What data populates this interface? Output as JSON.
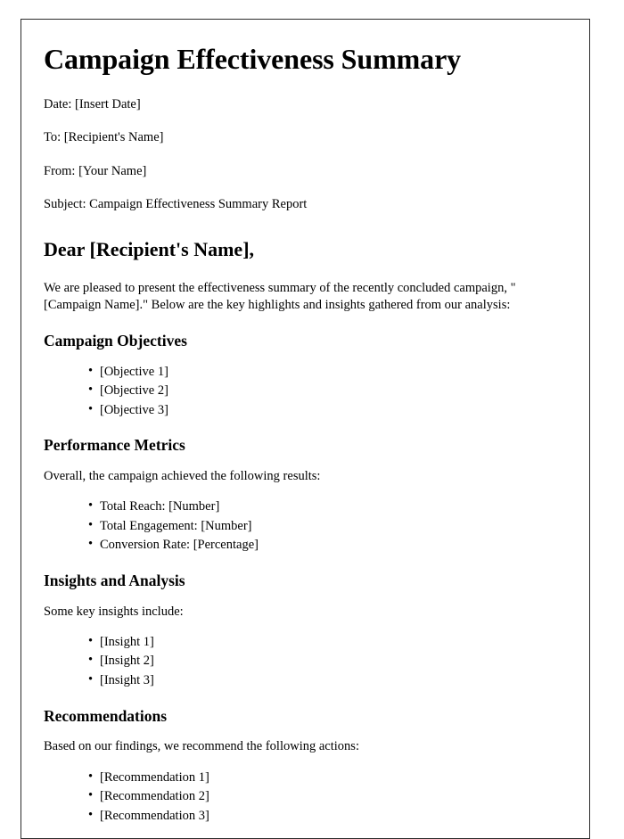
{
  "document": {
    "title": "Campaign Effectiveness Summary",
    "meta": [
      {
        "label": "Date:",
        "value": "[Insert Date]",
        "text": "Date: [Insert Date]"
      },
      {
        "label": "To:",
        "value": "[Recipient's Name]",
        "text": "To: [Recipient's Name]"
      },
      {
        "label": "From:",
        "value": "[Your Name]",
        "text": "From: [Your Name]"
      },
      {
        "label": "Subject:",
        "value": "Campaign Effectiveness Summary Report",
        "text": "Subject: Campaign Effectiveness Summary Report"
      }
    ],
    "salutation": "Dear [Recipient's Name],",
    "intro_paragraph": "We are pleased to present the effectiveness summary of the recently concluded campaign, \"[Campaign Name].\" Below are the key highlights and insights gathered from our analysis:",
    "sections": [
      {
        "heading": "Campaign Objectives",
        "lead_in": "",
        "items": [
          "[Objective 1]",
          "[Objective 2]",
          "[Objective 3]"
        ]
      },
      {
        "heading": "Performance Metrics",
        "lead_in": "Overall, the campaign achieved the following results:",
        "items": [
          "Total Reach: [Number]",
          "Total Engagement: [Number]",
          "Conversion Rate: [Percentage]"
        ]
      },
      {
        "heading": "Insights and Analysis",
        "lead_in": "Some key insights include:",
        "items": [
          "[Insight 1]",
          "[Insight 2]",
          "[Insight 3]"
        ]
      },
      {
        "heading": "Recommendations",
        "lead_in": "Based on our findings, we recommend the following actions:",
        "items": [
          "[Recommendation 1]",
          "[Recommendation 2]",
          "[Recommendation 3]"
        ]
      }
    ]
  }
}
